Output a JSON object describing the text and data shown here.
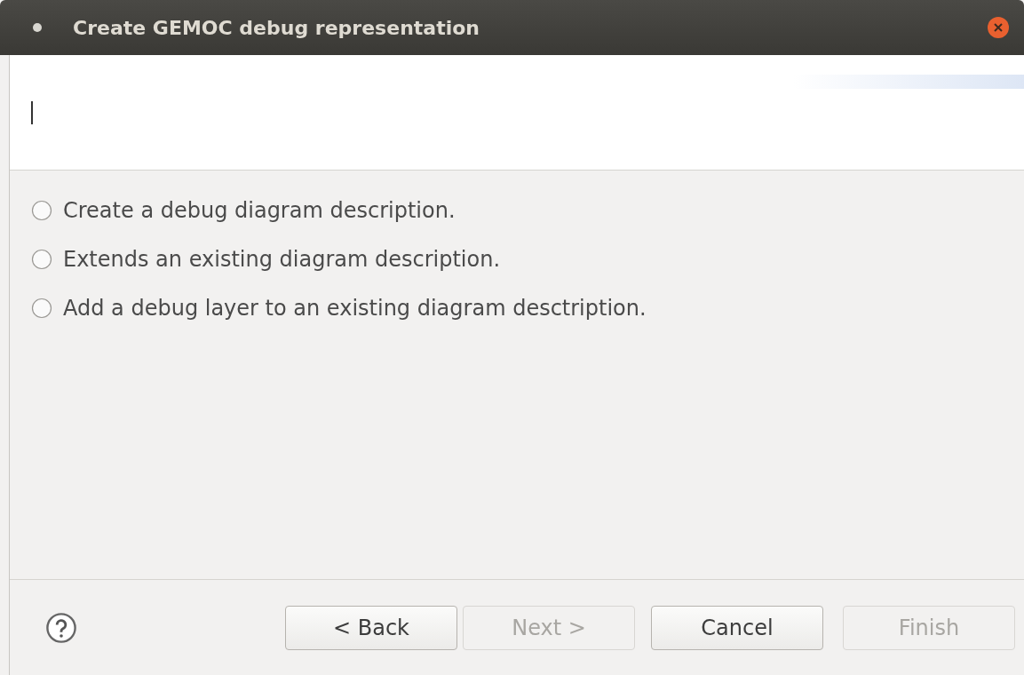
{
  "window": {
    "title": "Create GEMOC debug representation"
  },
  "options": [
    {
      "label": "Create a debug diagram description.",
      "selected": false
    },
    {
      "label": "Extends an existing diagram description.",
      "selected": false
    },
    {
      "label": "Add a debug layer to an existing diagram desctription.",
      "selected": false
    }
  ],
  "buttons": [
    {
      "label": "< Back",
      "disabled": false
    },
    {
      "label": "Next >",
      "disabled": true
    },
    {
      "label": "Cancel",
      "disabled": false
    },
    {
      "label": "Finish",
      "disabled": true
    }
  ]
}
